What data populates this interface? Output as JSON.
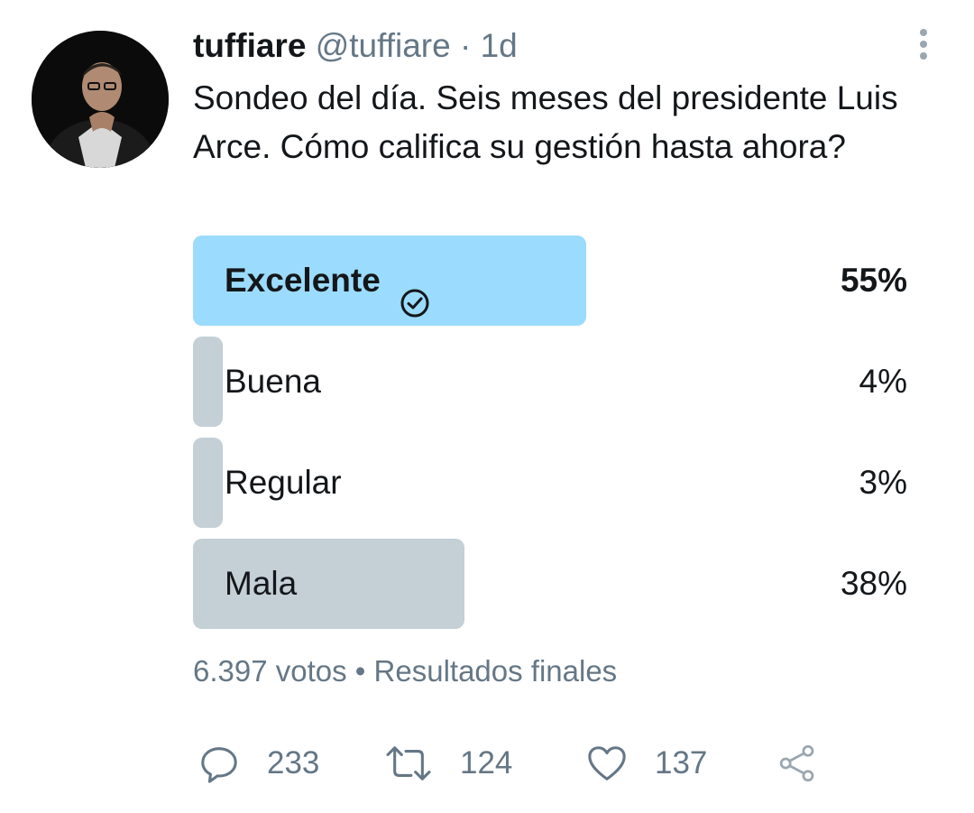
{
  "tweet": {
    "author": {
      "display_name": "tuffiare",
      "handle": "@tuffiare",
      "separator": "·",
      "time": "1d"
    },
    "text": "Sondeo del día. Seis meses del presidente Luis Arce. Cómo califica su gestión hasta ahora?",
    "poll": {
      "options": [
        {
          "label": "Excelente",
          "percent_text": "55%",
          "percent": 55,
          "winner": true
        },
        {
          "label": "Buena",
          "percent_text": "4%",
          "percent": 4,
          "winner": false
        },
        {
          "label": "Regular",
          "percent_text": "3%",
          "percent": 3,
          "winner": false
        },
        {
          "label": "Mala",
          "percent_text": "38%",
          "percent": 38,
          "winner": false
        }
      ],
      "votes": "6.397 votos",
      "bullet": "•",
      "status": "Resultados finales"
    },
    "actions": {
      "replies": "233",
      "retweets": "124",
      "likes": "137"
    }
  },
  "icons": {
    "more": "more-vertical-icon",
    "winner_check": "check-circle-icon",
    "reply": "reply-icon",
    "retweet": "retweet-icon",
    "like": "heart-icon",
    "share": "share-icon"
  },
  "colors": {
    "winner_bar": "#9bdbfd",
    "other_bar": "#c4cfd6",
    "secondary_text": "#657786",
    "primary_text": "#14171a"
  }
}
